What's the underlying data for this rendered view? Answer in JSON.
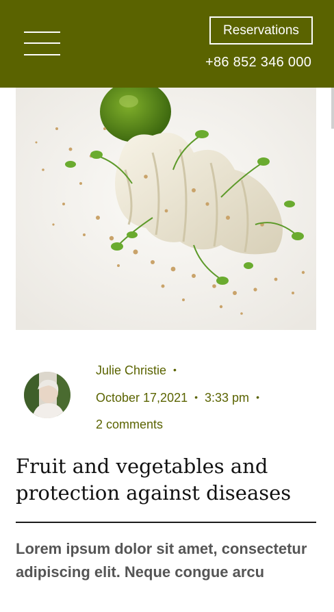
{
  "header": {
    "reservations_label": "Reservations",
    "phone": "+86 852 346 000",
    "menu_icon": "hamburger-menu-icon",
    "background_color": "#5a6300"
  },
  "post": {
    "image_icon": "food-dish-image",
    "avatar_icon": "author-avatar",
    "author": "Julie Christie",
    "date": "October 17,2021",
    "time": "3:33 pm",
    "comments": "2 comments",
    "title": "Fruit and vegetables and protection against diseases",
    "lead": "Lorem ipsum dolor sit amet, consectetur adipiscing elit. Neque congue arcu",
    "accent_color": "#5a6300"
  }
}
